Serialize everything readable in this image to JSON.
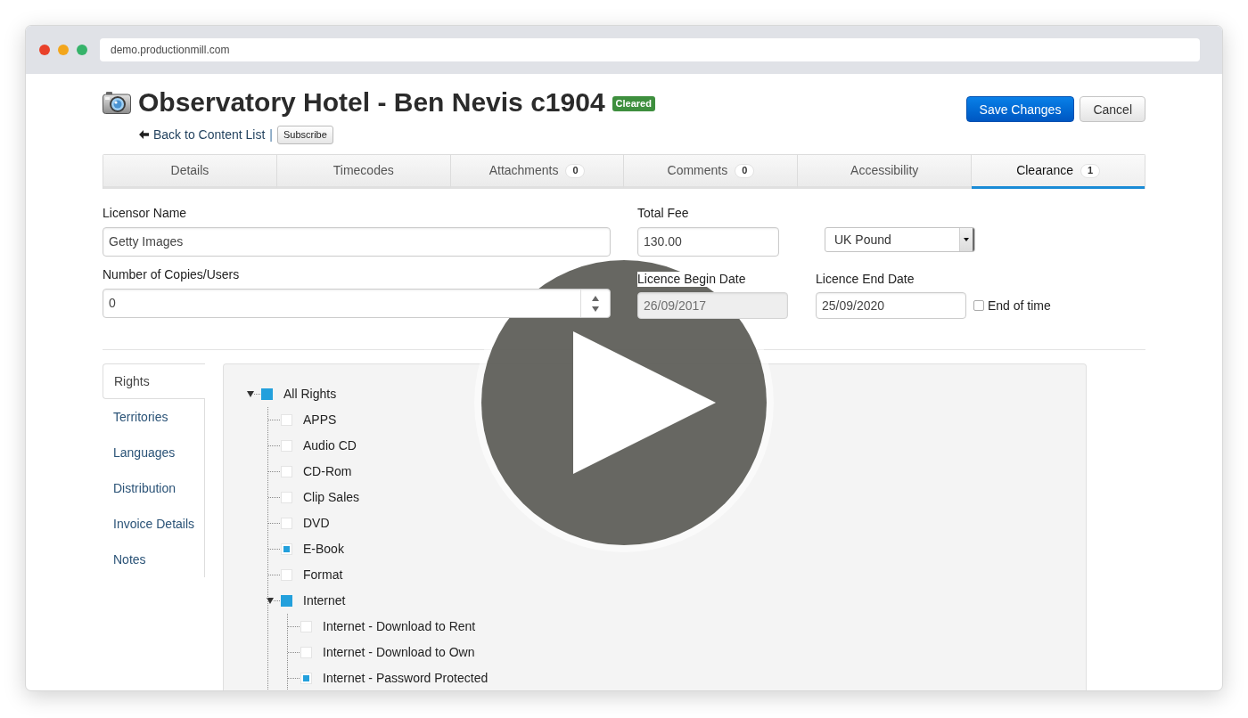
{
  "browser": {
    "url": "demo.productionmill.com"
  },
  "header": {
    "title": "Observatory Hotel - Ben Nevis c1904",
    "status_badge": "Cleared",
    "back_link": "Back to Content List",
    "separator": "|",
    "subscribe_button": "Subscribe",
    "buttons": [
      {
        "label": "Save Changes",
        "kind": "primary"
      },
      {
        "label": "Cancel",
        "kind": "default"
      }
    ]
  },
  "tabs": [
    {
      "label": "Details",
      "selected": false
    },
    {
      "label": "Timecodes",
      "selected": false
    },
    {
      "label": "Attachments",
      "count": "0",
      "selected": false
    },
    {
      "label": "Comments",
      "count": "0",
      "selected": false
    },
    {
      "label": "Accessibility",
      "selected": false
    },
    {
      "label": "Clearance",
      "count": "1",
      "selected": true
    }
  ],
  "form": {
    "licensor_name": {
      "label": "Licensor Name",
      "value": "Getty Images"
    },
    "copies": {
      "label": "Number of Copies/Users",
      "value": "0"
    },
    "total_fee": {
      "label": "Total Fee",
      "value": "130.00"
    },
    "currency": {
      "value": "UK Pound"
    },
    "begin_date": {
      "label": "Licence Begin Date",
      "value": "26/09/2017",
      "disabled": true
    },
    "end_date": {
      "label": "Licence End Date",
      "value": "25/09/2020",
      "disabled": false
    },
    "end_of_time": {
      "label": "End of time",
      "checked": false
    }
  },
  "side_tabs": [
    {
      "label": "Rights",
      "selected": true
    },
    {
      "label": "Territories",
      "selected": false
    },
    {
      "label": "Languages",
      "selected": false
    },
    {
      "label": "Distribution",
      "selected": false
    },
    {
      "label": "Invoice Details",
      "selected": false
    },
    {
      "label": "Notes",
      "selected": false
    }
  ],
  "rights_tree": [
    {
      "label": "All Rights",
      "checked": false,
      "undetermined": true,
      "expanded": true,
      "children": [
        {
          "label": "APPS",
          "checked": false,
          "undetermined": false
        },
        {
          "label": "Audio CD",
          "checked": false,
          "undetermined": false
        },
        {
          "label": "CD-Rom",
          "checked": false,
          "undetermined": false
        },
        {
          "label": "Clip Sales",
          "checked": false,
          "undetermined": false
        },
        {
          "label": "DVD",
          "checked": false,
          "undetermined": false
        },
        {
          "label": "E-Book",
          "checked": true,
          "undetermined": false
        },
        {
          "label": "Format",
          "checked": false,
          "undetermined": false
        },
        {
          "label": "Internet",
          "checked": false,
          "undetermined": true,
          "expanded": true,
          "children": [
            {
              "label": "Internet - Download to Rent",
              "checked": false,
              "undetermined": false
            },
            {
              "label": "Internet - Download to Own",
              "checked": false,
              "undetermined": false
            },
            {
              "label": "Internet - Password Protected",
              "checked": true,
              "undetermined": false
            }
          ]
        }
      ]
    }
  ]
}
